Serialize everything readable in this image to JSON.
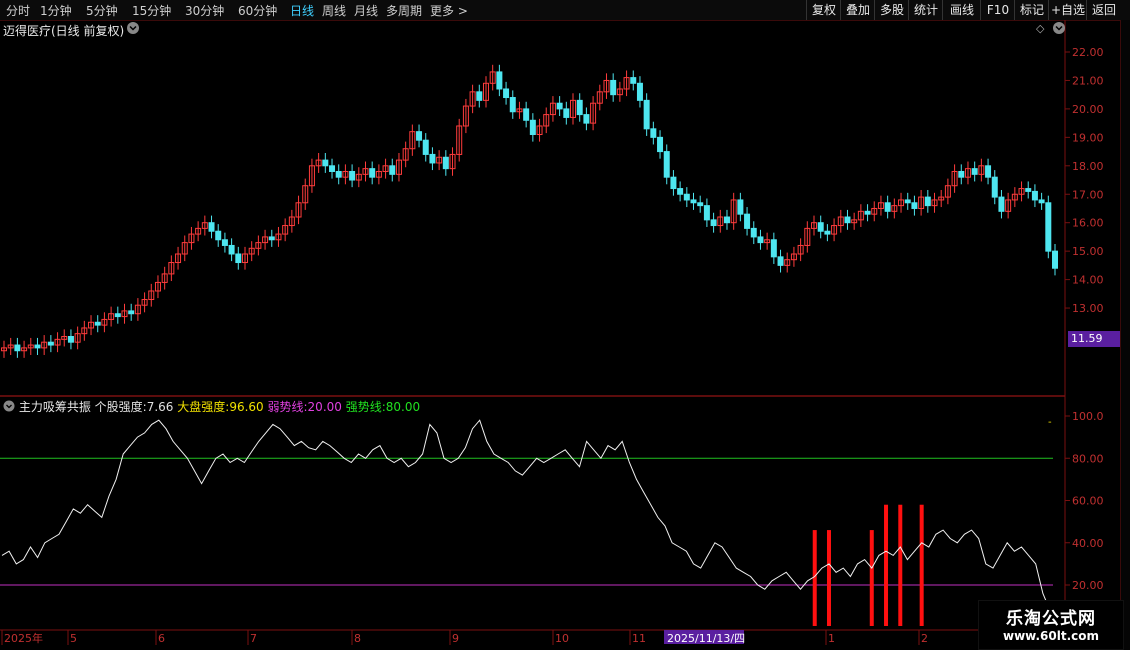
{
  "toolbar": {
    "periods": [
      "分时",
      "1分钟",
      "5分钟",
      "15分钟",
      "30分钟",
      "60分钟",
      "日线",
      "周线",
      "月线",
      "多周期",
      "更多 >"
    ],
    "active_period": "日线",
    "right_buttons": [
      "复权",
      "叠加",
      "多股",
      "统计",
      "画线",
      "F10",
      "标记",
      "+自选",
      "返回"
    ]
  },
  "chart_header": {
    "stock_title": "迈得医疗(日线 前复权)"
  },
  "indicator_header": {
    "name": "主力吸筹共振",
    "items": [
      {
        "label": "个股强度:",
        "value": "7.66",
        "color": "#e0e0e0"
      },
      {
        "label": "大盘强度:",
        "value": "96.60",
        "color": "#f0e000"
      },
      {
        "label": "弱势线:",
        "value": "20.00",
        "color": "#e040e0"
      },
      {
        "label": "强势线:",
        "value": "80.00",
        "color": "#20e020"
      }
    ]
  },
  "price_axis": [
    "22.00",
    "21.00",
    "20.00",
    "19.00",
    "18.00",
    "17.00",
    "16.00",
    "15.00",
    "14.00",
    "13.00"
  ],
  "indicator_axis": [
    "100.0",
    "80.00",
    "60.00",
    "40.00",
    "20.00"
  ],
  "last_price_badge": "11.59",
  "date_axis": [
    {
      "label": "2025年"
    },
    {
      "label": "5"
    },
    {
      "label": "6"
    },
    {
      "label": "7"
    },
    {
      "label": "8"
    },
    {
      "label": "9"
    },
    {
      "label": "10"
    },
    {
      "label": "11"
    },
    {
      "label": "1"
    },
    {
      "label": "2"
    }
  ],
  "cursor_date": "2025/11/13/四",
  "watermark": {
    "line1": "乐淘公式网",
    "line2": "www.60lt.com"
  },
  "colors": {
    "up": "#ff3c3c",
    "down": "#4ee6f0",
    "strong_line": "#20c020",
    "weak_line": "#c030c0",
    "signal": "#ff1010",
    "curve": "#f0f0f0",
    "grid": "#5a0a0a"
  },
  "chart_data": {
    "type": "candlestick",
    "price_series": [
      11.6,
      11.7,
      11.5,
      11.6,
      11.7,
      11.6,
      11.8,
      11.7,
      11.9,
      12.0,
      11.8,
      12.1,
      12.3,
      12.5,
      12.4,
      12.6,
      12.8,
      12.7,
      12.9,
      12.8,
      13.1,
      13.3,
      13.6,
      13.9,
      14.2,
      14.6,
      14.9,
      15.3,
      15.6,
      15.8,
      16.0,
      15.7,
      15.4,
      15.2,
      14.9,
      14.6,
      14.9,
      15.1,
      15.3,
      15.5,
      15.4,
      15.6,
      15.9,
      16.2,
      16.7,
      17.3,
      18.0,
      18.2,
      18.0,
      17.8,
      17.6,
      17.8,
      17.5,
      17.7,
      17.9,
      17.6,
      17.8,
      18.0,
      17.7,
      18.2,
      18.6,
      19.2,
      18.9,
      18.4,
      18.1,
      18.3,
      17.9,
      18.4,
      19.4,
      20.1,
      20.6,
      20.3,
      20.9,
      21.3,
      20.7,
      20.4,
      19.9,
      20.0,
      19.6,
      19.1,
      19.4,
      19.8,
      20.2,
      20.0,
      19.7,
      20.3,
      19.8,
      19.5,
      20.2,
      20.6,
      21.0,
      20.5,
      20.7,
      21.1,
      20.9,
      20.3,
      19.3,
      19.0,
      18.5,
      17.6,
      17.2,
      17.0,
      16.8,
      16.7,
      16.6,
      16.1,
      15.9,
      16.2,
      16.0,
      16.8,
      16.3,
      15.8,
      15.5,
      15.3,
      15.4,
      14.8,
      14.5,
      14.7,
      14.9,
      15.2,
      15.8,
      16.0,
      15.7,
      15.6,
      15.9,
      16.2,
      16.0,
      16.1,
      16.4,
      16.3,
      16.5,
      16.7,
      16.4,
      16.6,
      16.8,
      16.7,
      16.5,
      16.9,
      16.6,
      16.8,
      16.9,
      17.3,
      17.8,
      17.6,
      17.9,
      17.7,
      18.0,
      17.6,
      16.9,
      16.4,
      16.8,
      17.0,
      17.2,
      17.1,
      16.8,
      16.7,
      15.0,
      14.4
    ],
    "indicator_series": [
      34,
      36,
      30,
      32,
      38,
      33,
      40,
      42,
      44,
      50,
      56,
      54,
      58,
      55,
      52,
      62,
      70,
      82,
      86,
      90,
      92,
      96,
      98,
      94,
      88,
      84,
      80,
      74,
      68,
      74,
      80,
      82,
      78,
      80,
      78,
      83,
      88,
      92,
      96,
      94,
      90,
      86,
      88,
      85,
      84,
      88,
      86,
      83,
      80,
      78,
      82,
      80,
      84,
      86,
      80,
      78,
      80,
      76,
      78,
      82,
      96,
      92,
      80,
      78,
      80,
      85,
      94,
      98,
      88,
      82,
      80,
      78,
      74,
      72,
      76,
      80,
      78,
      80,
      82,
      84,
      80,
      76,
      88,
      84,
      80,
      86,
      84,
      88,
      78,
      70,
      64,
      58,
      52,
      48,
      40,
      38,
      36,
      30,
      28,
      34,
      40,
      38,
      33,
      28,
      26,
      24,
      20,
      18,
      22,
      24,
      26,
      22,
      18,
      22,
      24,
      28,
      30,
      26,
      28,
      24,
      30,
      32,
      28,
      34,
      36,
      34,
      38,
      32,
      36,
      40,
      38,
      44,
      46,
      42,
      40,
      44,
      46,
      42,
      30,
      28,
      34,
      40,
      36,
      38,
      34,
      30,
      16,
      8
    ],
    "strong_line": 80,
    "weak_line": 20,
    "signal_bars": [
      114,
      116,
      122,
      124,
      126,
      129
    ]
  }
}
